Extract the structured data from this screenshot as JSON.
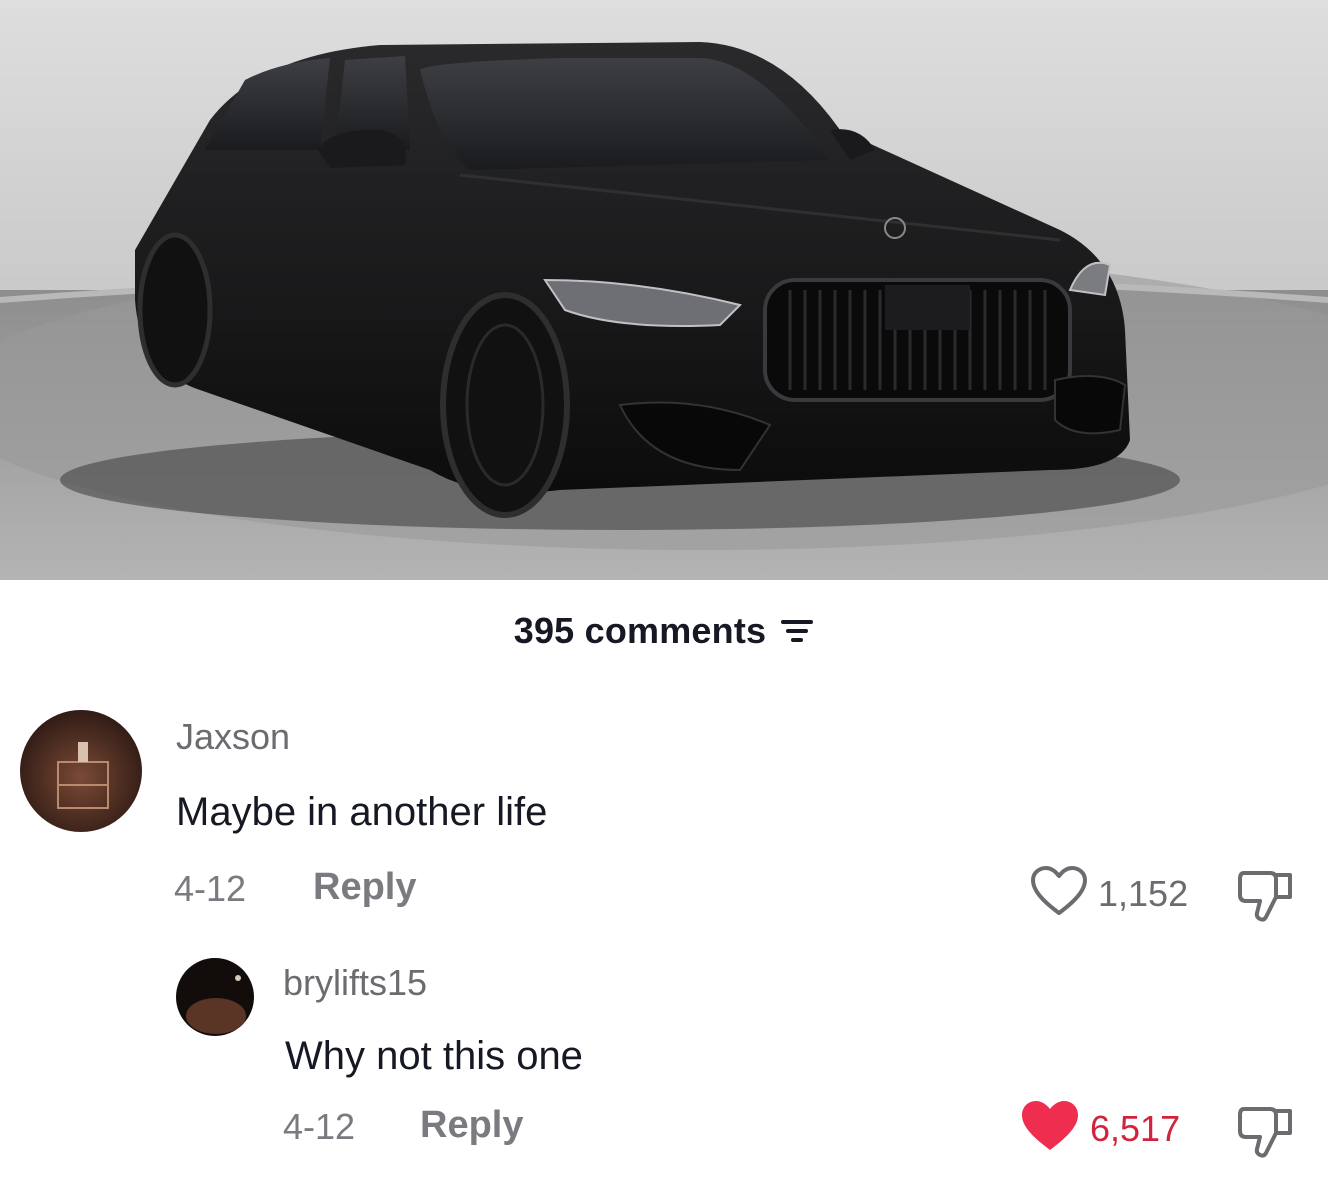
{
  "video": {
    "image_description": "black luxury sedan photo"
  },
  "comments_header": {
    "count_label": "395 comments",
    "sort_icon": "filter-lines-icon"
  },
  "comments": [
    {
      "username": "Jaxson",
      "text": "Maybe in another life",
      "date": "4-12",
      "reply_label": "Reply",
      "likes": "1,152",
      "liked": false,
      "like_icon": "heart-outline-icon",
      "dislike_icon": "thumbs-down-icon"
    },
    {
      "username": "brylifts15",
      "text": "Why not this one",
      "date": "4-12",
      "reply_label": "Reply",
      "likes": "6,517",
      "liked": true,
      "like_icon": "heart-filled-icon",
      "dislike_icon": "thumbs-down-icon"
    }
  ],
  "colors": {
    "liked_heart": "#ee2d4f",
    "muted_text": "#7a7a80"
  }
}
